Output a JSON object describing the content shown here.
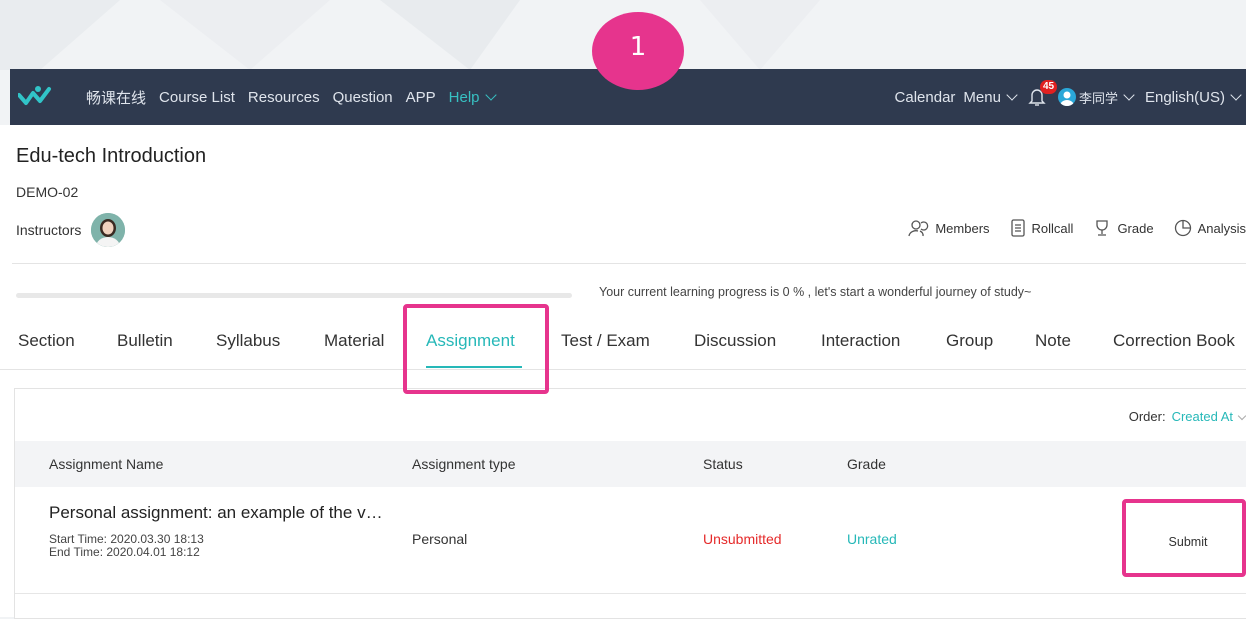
{
  "step_badge": "1",
  "nav": {
    "brand": "畅课在线",
    "links": [
      "Course List",
      "Resources",
      "Question",
      "APP"
    ],
    "help": "Help",
    "calendar": "Calendar",
    "menu": "Menu",
    "notification_count": "45",
    "user": "李同学",
    "language": "English(US)"
  },
  "course": {
    "title": "Edu-tech Introduction",
    "code": "DEMO-02",
    "instructors_label": "Instructors"
  },
  "tools": {
    "members": "Members",
    "rollcall": "Rollcall",
    "grade": "Grade",
    "analysis": "Analysis"
  },
  "progress": {
    "percent": 0,
    "text": "Your current learning progress is 0 % , let's start a wonderful journey of study~"
  },
  "tabs": [
    "Section",
    "Bulletin",
    "Syllabus",
    "Material",
    "Assignment",
    "Test / Exam",
    "Discussion",
    "Interaction",
    "Group",
    "Note",
    "Correction Book"
  ],
  "active_tab": "Assignment",
  "order": {
    "label": "Order:",
    "value": "Created At"
  },
  "table": {
    "headers": {
      "name": "Assignment Name",
      "type": "Assignment type",
      "status": "Status",
      "grade": "Grade"
    },
    "rows": [
      {
        "name": "Personal assignment: an example of the v…",
        "start": "Start Time:  2020.03.30 18:13",
        "end": "End Time:  2020.04.01 18:12",
        "type": "Personal",
        "status": "Unsubmitted",
        "grade": "Unrated",
        "action": "Submit"
      }
    ]
  },
  "colors": {
    "nav_bg": "#2f3a4f",
    "accent": "#26b8b8",
    "highlight": "#e6348d",
    "status_red": "#e52a2a"
  }
}
